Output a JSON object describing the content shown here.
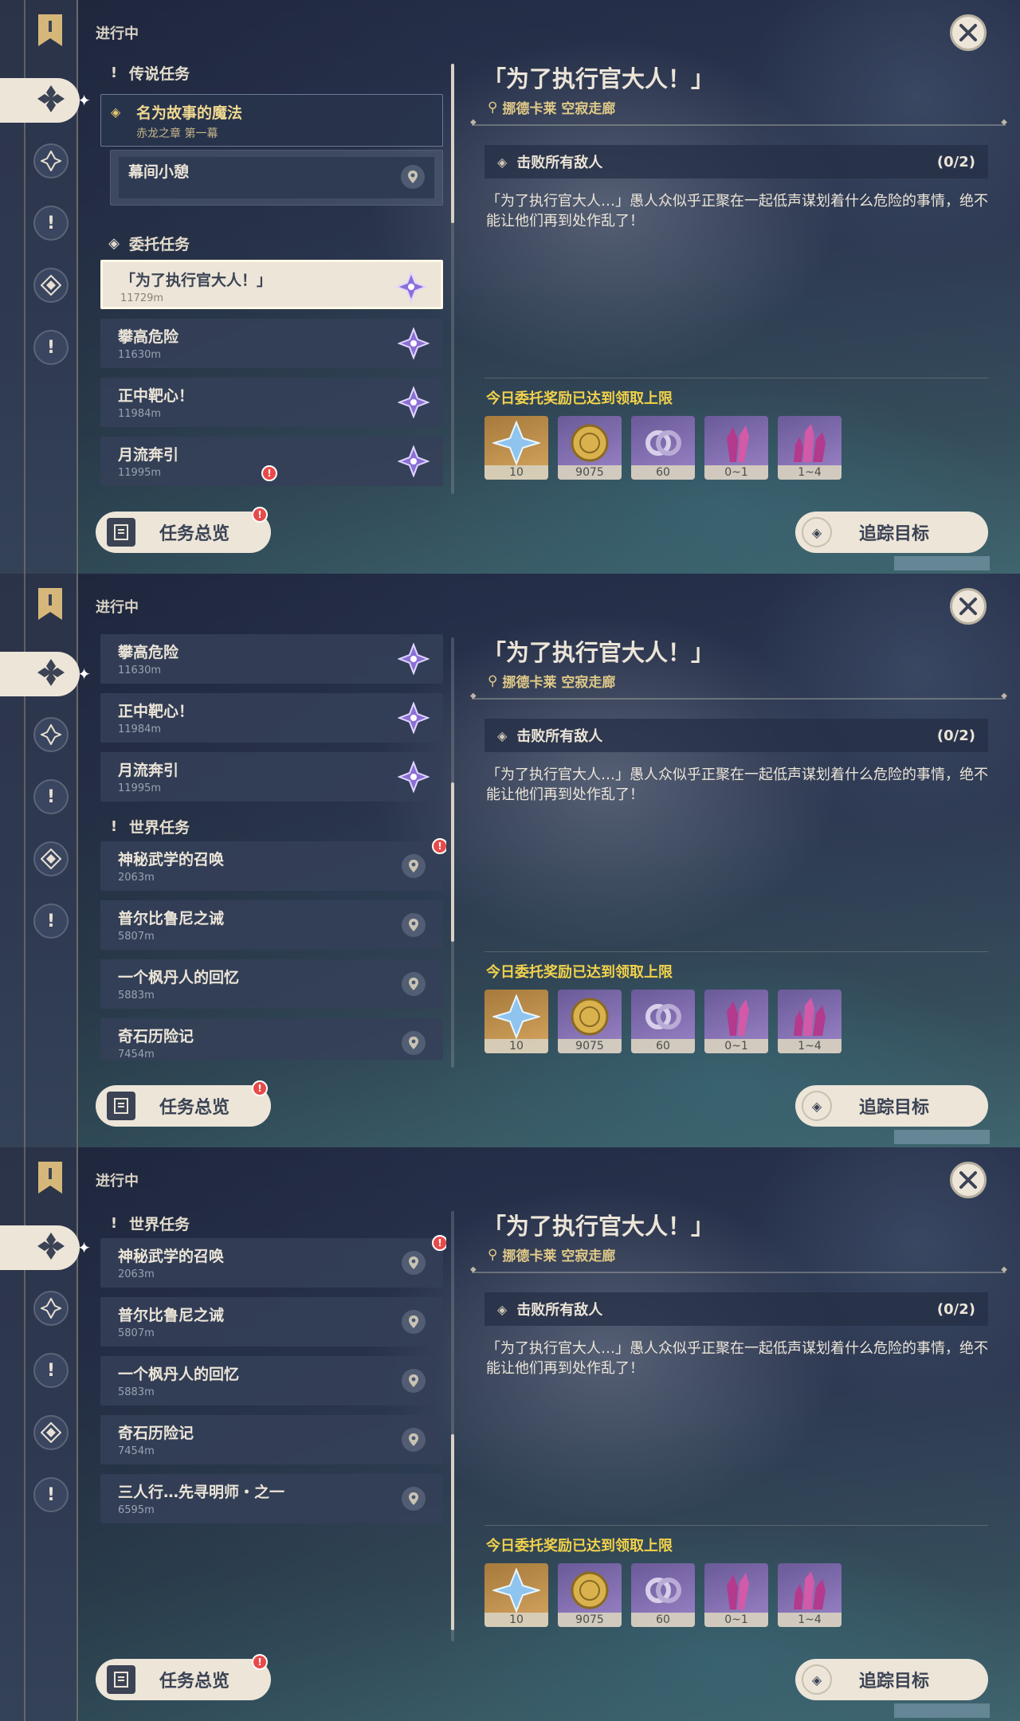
{
  "header": {
    "in_progress": "进行中"
  },
  "detail": {
    "title": "「为了执行官大人！」",
    "location": "挪德卡莱 空寂走廊",
    "objective": "击败所有敌人",
    "objective_count": "(0/2)",
    "description": "「为了执行官大人…」愚人众似乎正聚在一起低声谋划着什么危险的事情，绝不能让他们再到处作乱了！",
    "reward_limit": "今日委托奖励已达到领取上限",
    "rewards": [
      {
        "icon": "primogem-icon",
        "qty": "10"
      },
      {
        "icon": "mora-icon",
        "qty": "9075"
      },
      {
        "icon": "companionship-exp-icon",
        "qty": "60"
      },
      {
        "icon": "crystal-icon",
        "qty": "0~1"
      },
      {
        "icon": "crystal-cluster-icon",
        "qty": "1~4"
      }
    ]
  },
  "buttons": {
    "overview": "任务总览",
    "track": "追踪目标",
    "alert": "!"
  },
  "categories": {
    "legend": "传说任务",
    "commission": "委托任务",
    "world": "世界任务"
  },
  "legend_quest": {
    "name": "名为故事的魔法",
    "sub": "赤龙之章 第一幕",
    "step": "幕间小憩"
  },
  "commissions": [
    {
      "name": "「为了执行官大人！」",
      "dist": "11729m"
    },
    {
      "name": "攀高危险",
      "dist": "11630m"
    },
    {
      "name": "正中靶心！",
      "dist": "11984m"
    },
    {
      "name": "月流奔引",
      "dist": "11995m"
    }
  ],
  "world_quests": [
    {
      "name": "神秘武学的召唤",
      "dist": "2063m"
    },
    {
      "name": "普尔比鲁尼之诫",
      "dist": "5807m"
    },
    {
      "name": "一个枫丹人的回忆",
      "dist": "5883m"
    },
    {
      "name": "奇石历险记",
      "dist": "7454m"
    },
    {
      "name": "三人行…先寻明师・之一",
      "dist": "6595m"
    }
  ]
}
